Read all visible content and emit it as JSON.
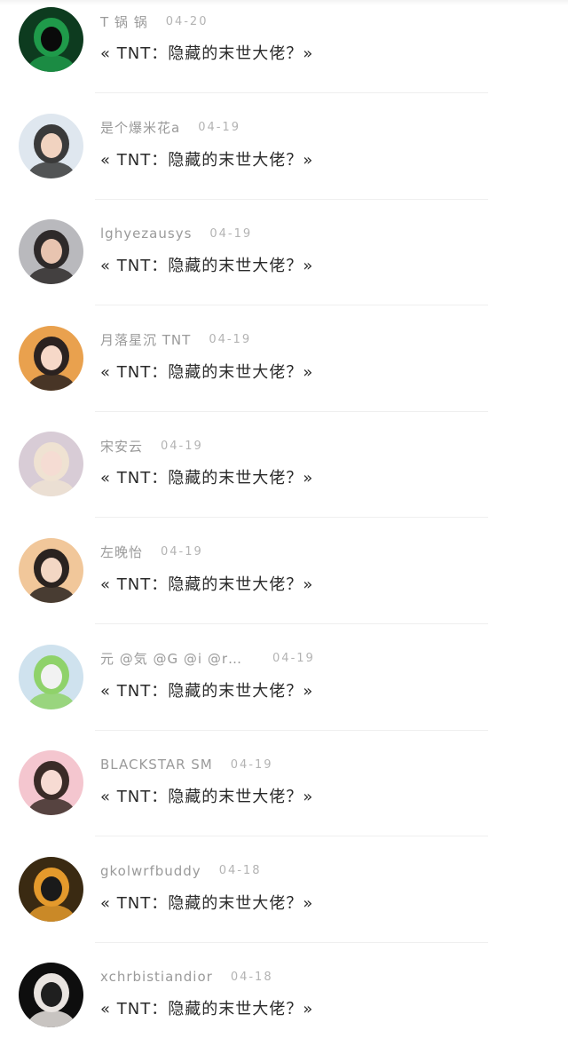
{
  "comments": [
    {
      "name": "T 锅 锅",
      "date": "04-20",
      "text": "« TNT：隐藏的末世大佬？»",
      "avatar_colors": [
        "#0d3b1f",
        "#1f9a4a",
        "#0a0a0a"
      ]
    },
    {
      "name": "是个爆米花a",
      "date": "04-19",
      "text": "« TNT：隐藏的末世大佬？»",
      "avatar_colors": [
        "#dfe7ef",
        "#3a3a3a",
        "#f1d3c0"
      ]
    },
    {
      "name": "lghyezausys",
      "date": "04-19",
      "text": "« TNT：隐藏的末世大佬？»",
      "avatar_colors": [
        "#b9b9bd",
        "#2e2a2a",
        "#e8c4b0"
      ]
    },
    {
      "name": "月落星沉 TNT",
      "date": "04-19",
      "text": "« TNT：隐藏的末世大佬？»",
      "avatar_colors": [
        "#e9a14e",
        "#2b2220",
        "#f6d8c8"
      ]
    },
    {
      "name": "宋安云",
      "date": "04-19",
      "text": "« TNT：隐藏的末世大佬？»",
      "avatar_colors": [
        "#d8ccd6",
        "#efe2d2",
        "#f5dcd3"
      ]
    },
    {
      "name": "左晚怡",
      "date": "04-19",
      "text": "« TNT：隐藏的末世大佬？»",
      "avatar_colors": [
        "#f1c79a",
        "#2a2320",
        "#f3d7c4"
      ]
    },
    {
      "name": "元 @気 @G @i @r…",
      "date": "04-19",
      "text": "« TNT：隐藏的末世大佬？»",
      "avatar_colors": [
        "#cfe2ee",
        "#8fd26a",
        "#f2f2f2"
      ]
    },
    {
      "name": "BLACKSTAR SM",
      "date": "04-19",
      "text": "« TNT：隐藏的末世大佬？»",
      "avatar_colors": [
        "#f4c6cf",
        "#3a2b27",
        "#f7dbd3"
      ]
    },
    {
      "name": "gkolwrfbuddy",
      "date": "04-18",
      "text": "« TNT：隐藏的末世大佬？»",
      "avatar_colors": [
        "#3a2a12",
        "#e49a2c",
        "#1a1a1a"
      ]
    },
    {
      "name": "xchrbistiandior",
      "date": "04-18",
      "text": "« TNT：隐藏的末世大佬？»",
      "avatar_colors": [
        "#0e0e0e",
        "#e9e4e0",
        "#1f1f1f"
      ]
    }
  ]
}
